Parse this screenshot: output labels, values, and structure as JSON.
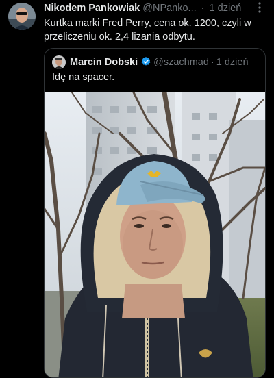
{
  "tweet": {
    "author_name": "Nikodem Pankowiak",
    "author_handle": "@NPanko...",
    "separator": "·",
    "time": "1 dzień",
    "text": "Kurtka marki Fred Perry, cena ok. 1200, czyli w przeliczeniu ok. 2,4 lizania odbytu.",
    "more_icon": "more-vertical-icon"
  },
  "quote": {
    "author_name": "Marcin Dobski",
    "author_handle": "@szachmad",
    "separator": "·",
    "time": "1 dzień",
    "text": "Idę na spacer.",
    "verified_icon": "verified-badge-icon",
    "verified_color": "#1d9bf0"
  },
  "colors": {
    "background": "#000000",
    "text_primary": "#e7e9ea",
    "text_secondary": "#71767b",
    "border": "#2f3336"
  }
}
